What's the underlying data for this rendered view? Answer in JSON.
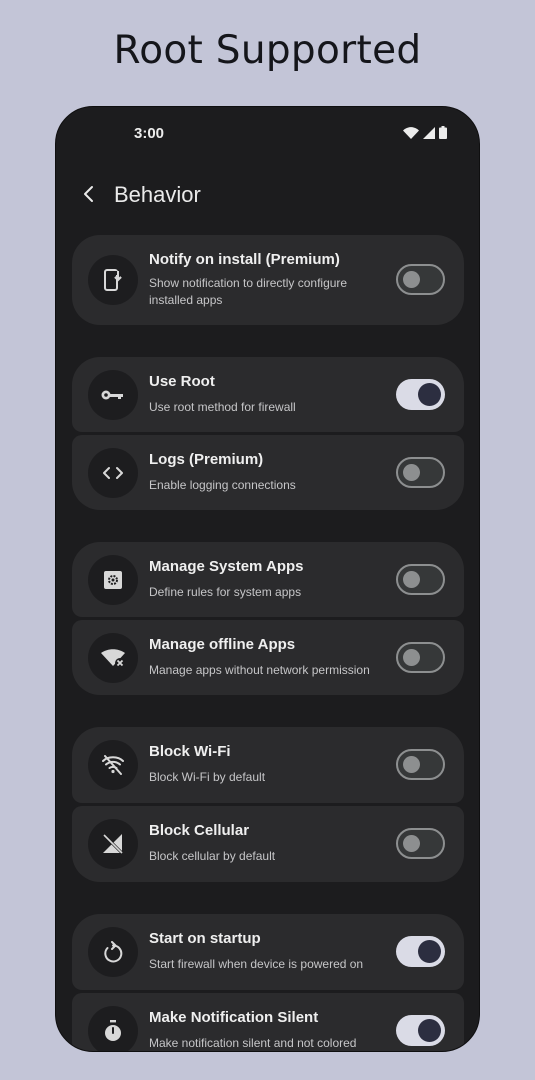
{
  "headline": "Root Supported",
  "status_bar": {
    "time": "3:00"
  },
  "app_bar": {
    "title": "Behavior"
  },
  "groups": [
    {
      "items": [
        {
          "title": "Notify on install (Premium)",
          "subtitle": "Show notification to directly configure installed apps",
          "icon": "install-mobile-icon",
          "enabled": false
        }
      ]
    },
    {
      "items": [
        {
          "title": "Use Root",
          "subtitle": "Use root method for firewall",
          "icon": "key-icon",
          "enabled": true
        },
        {
          "title": "Logs (Premium)",
          "subtitle": "Enable logging connections",
          "icon": "code-icon",
          "enabled": false
        }
      ]
    },
    {
      "items": [
        {
          "title": "Manage System Apps",
          "subtitle": "Define rules for system apps",
          "icon": "settings-app-icon",
          "enabled": false
        },
        {
          "title": "Manage offline Apps",
          "subtitle": "Manage apps without network permission",
          "icon": "wifi-off-icon",
          "enabled": false
        }
      ]
    },
    {
      "items": [
        {
          "title": "Block Wi-Fi",
          "subtitle": "Block Wi-Fi by default",
          "icon": "wifi-blocked-icon",
          "enabled": false
        },
        {
          "title": "Block Cellular",
          "subtitle": "Block cellular by default",
          "icon": "cellular-off-icon",
          "enabled": false
        }
      ]
    },
    {
      "items": [
        {
          "title": "Start on startup",
          "subtitle": "Start firewall when device is powered on",
          "icon": "restart-icon",
          "enabled": true
        },
        {
          "title": "Make Notification Silent",
          "subtitle": "Make notification silent and not colored",
          "icon": "timer-icon",
          "enabled": true
        }
      ]
    }
  ],
  "colors": {
    "background": "#c3c5d7",
    "phone": "#1c1c1e",
    "card": "#2b2b2d",
    "toggle_on": "#dadbe6",
    "knob_on": "#2c2e40"
  }
}
